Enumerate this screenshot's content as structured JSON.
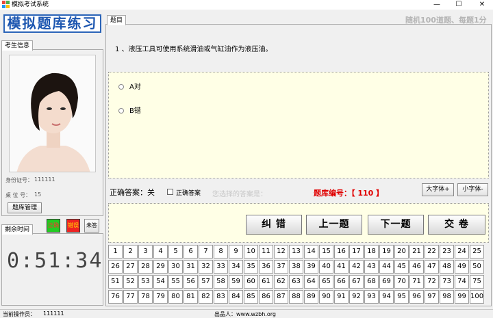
{
  "window": {
    "title": "模拟考试系统",
    "minimize": "—",
    "maximize": "☐",
    "close": "✕"
  },
  "logo": "模拟题库练习",
  "student": {
    "tab": "考生信息",
    "id_label": "身份证号：",
    "id_value": "111111",
    "seat_label": "桌 位 号：",
    "seat_value": "15",
    "manage_button": "题库管理"
  },
  "timer": {
    "tab": "剩余时间",
    "legend_correct": "正确",
    "legend_wrong": "错误",
    "legend_unanswered": "未答",
    "value": "0:51:34"
  },
  "question": {
    "tab": "题目",
    "hint": "随机100道题、每题1分",
    "number": "1",
    "text": "1 、液压工具可使用系统滑油或气缸油作为液压油。",
    "options": [
      "A对",
      "B错"
    ]
  },
  "answer_bar": {
    "correct_answer_label": "正确答案：关",
    "show_answer_checkbox": "正确答案",
    "your_answer": "您选择的答案是：",
    "bank_number": "题库编号：【 110 】",
    "big_font": "大字体+",
    "small_font": "小字体-"
  },
  "actions": {
    "correct": "纠 错",
    "prev": "上一题",
    "next": "下一题",
    "submit": "交 卷"
  },
  "question_numbers": [
    1,
    2,
    3,
    4,
    5,
    6,
    7,
    8,
    9,
    10,
    11,
    12,
    13,
    14,
    15,
    16,
    17,
    18,
    19,
    20,
    21,
    22,
    23,
    24,
    25,
    26,
    27,
    28,
    29,
    30,
    31,
    32,
    33,
    34,
    35,
    36,
    37,
    38,
    39,
    40,
    41,
    42,
    43,
    44,
    45,
    46,
    47,
    48,
    49,
    50,
    51,
    52,
    53,
    54,
    55,
    56,
    57,
    58,
    59,
    60,
    61,
    62,
    63,
    64,
    65,
    66,
    67,
    68,
    69,
    70,
    71,
    72,
    73,
    74,
    75,
    76,
    77,
    78,
    79,
    80,
    81,
    82,
    83,
    84,
    85,
    86,
    87,
    88,
    89,
    90,
    91,
    92,
    93,
    94,
    95,
    96,
    97,
    98,
    99,
    100
  ],
  "statusbar": {
    "operator_label": "当前操作员：",
    "operator_value": "111111",
    "publisher": "出品人：www.wzbh.org"
  },
  "colors": {
    "correct": "#22cc22",
    "wrong": "#ee2222",
    "accent": "#2b64b8",
    "answer_bg": "#ffffe6"
  }
}
